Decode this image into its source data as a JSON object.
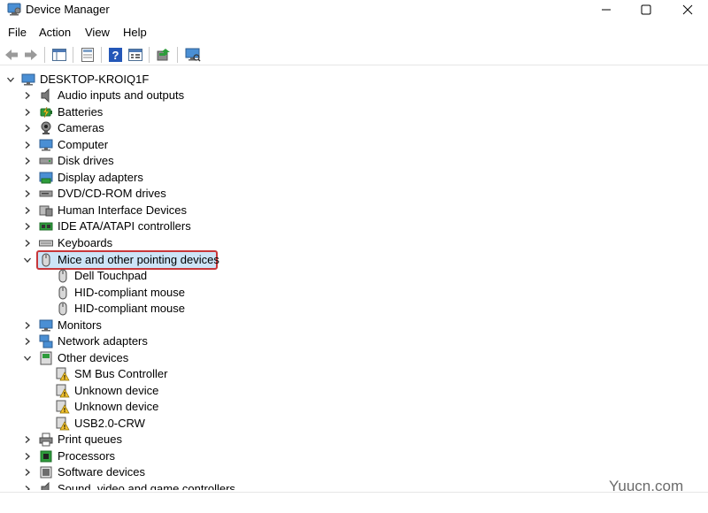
{
  "window": {
    "title": "Device Manager",
    "icon": "device-manager-icon",
    "controls": [
      "minimize-icon",
      "maximize-icon",
      "close-icon"
    ]
  },
  "menu": {
    "items": [
      "File",
      "Action",
      "View",
      "Help"
    ]
  },
  "toolbar": {
    "buttons": [
      "back-arrow-icon",
      "forward-arrow-icon",
      "show-hide-console-tree-icon",
      "properties-icon",
      "help-icon",
      "view-icon",
      "update-driver-icon",
      "scan-hardware-icon"
    ]
  },
  "tree": {
    "root": "DESKTOP-KROIQ1F",
    "categories": [
      {
        "label": "Audio inputs and outputs",
        "icon": "speaker-icon",
        "expanded": false
      },
      {
        "label": "Batteries",
        "icon": "battery-icon",
        "expanded": false
      },
      {
        "label": "Cameras",
        "icon": "camera-icon",
        "expanded": false
      },
      {
        "label": "Computer",
        "icon": "computer-icon",
        "expanded": false
      },
      {
        "label": "Disk drives",
        "icon": "disk-drive-icon",
        "expanded": false
      },
      {
        "label": "Display adapters",
        "icon": "display-adapter-icon",
        "expanded": false
      },
      {
        "label": "DVD/CD-ROM drives",
        "icon": "dvd-drive-icon",
        "expanded": false
      },
      {
        "label": "Human Interface Devices",
        "icon": "hid-icon",
        "expanded": false
      },
      {
        "label": "IDE ATA/ATAPI controllers",
        "icon": "ide-controller-icon",
        "expanded": false
      },
      {
        "label": "Keyboards",
        "icon": "keyboard-icon",
        "expanded": false
      },
      {
        "label": "Mice and other pointing devices",
        "icon": "mouse-icon",
        "expanded": true,
        "selected": true,
        "children": [
          {
            "label": "Dell Touchpad",
            "icon": "mouse-icon"
          },
          {
            "label": "HID-compliant mouse",
            "icon": "mouse-icon"
          },
          {
            "label": "HID-compliant mouse",
            "icon": "mouse-icon"
          }
        ]
      },
      {
        "label": "Monitors",
        "icon": "monitor-icon",
        "expanded": false
      },
      {
        "label": "Network adapters",
        "icon": "network-adapter-icon",
        "expanded": false
      },
      {
        "label": "Other devices",
        "icon": "other-devices-icon",
        "expanded": true,
        "children": [
          {
            "label": "SM Bus Controller",
            "icon": "unknown-device-warning-icon"
          },
          {
            "label": "Unknown device",
            "icon": "unknown-device-warning-icon"
          },
          {
            "label": "Unknown device",
            "icon": "unknown-device-warning-icon"
          },
          {
            "label": "USB2.0-CRW",
            "icon": "unknown-device-warning-icon"
          }
        ]
      },
      {
        "label": "Print queues",
        "icon": "printer-icon",
        "expanded": false
      },
      {
        "label": "Processors",
        "icon": "processor-icon",
        "expanded": false
      },
      {
        "label": "Software devices",
        "icon": "software-device-icon",
        "expanded": false
      },
      {
        "label": "Sound, video and game controllers",
        "icon": "sound-controller-icon",
        "expanded": false
      }
    ]
  },
  "highlight_color": "#c8373a",
  "watermark": "Yuucn.com"
}
